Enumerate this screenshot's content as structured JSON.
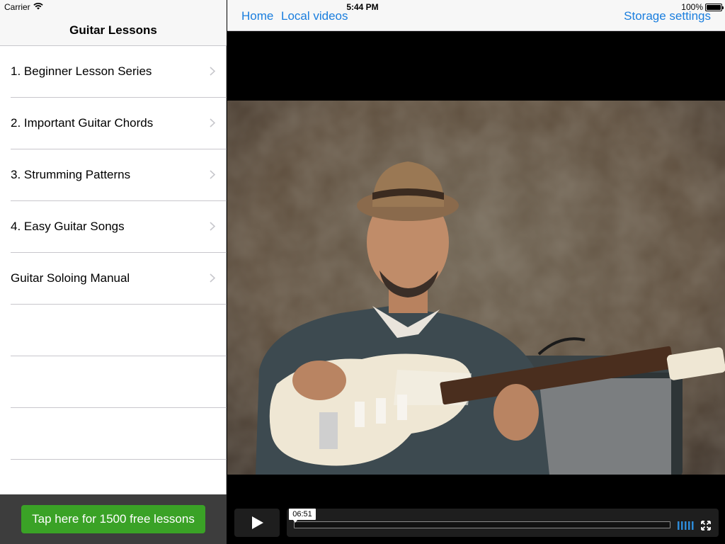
{
  "status_bar": {
    "carrier": "Carrier",
    "time": "5:44 PM",
    "battery": "100%"
  },
  "left_pane": {
    "title": "Guitar Lessons",
    "items": [
      {
        "label": "1. Beginner Lesson Series"
      },
      {
        "label": "2. Important Guitar Chords"
      },
      {
        "label": "3. Strumming Patterns"
      },
      {
        "label": "4. Easy Guitar Songs"
      },
      {
        "label": "Guitar Soloing Manual"
      }
    ],
    "promo_button": "Tap here for 1500 free lessons"
  },
  "right_pane": {
    "nav": {
      "home": "Home",
      "local_videos": "Local videos",
      "storage_settings": "Storage settings"
    },
    "player": {
      "time_tooltip": "06:51",
      "progress": 0
    }
  },
  "colors": {
    "link_blue": "#1a7ede",
    "promo_green": "#3aa226",
    "footer_dark": "#3d3d3d",
    "volume_blue": "#2d8bd8"
  },
  "icons": [
    "wifi-icon",
    "battery-icon",
    "chevron-right-icon",
    "play-icon",
    "volume-icon",
    "fullscreen-icon"
  ]
}
